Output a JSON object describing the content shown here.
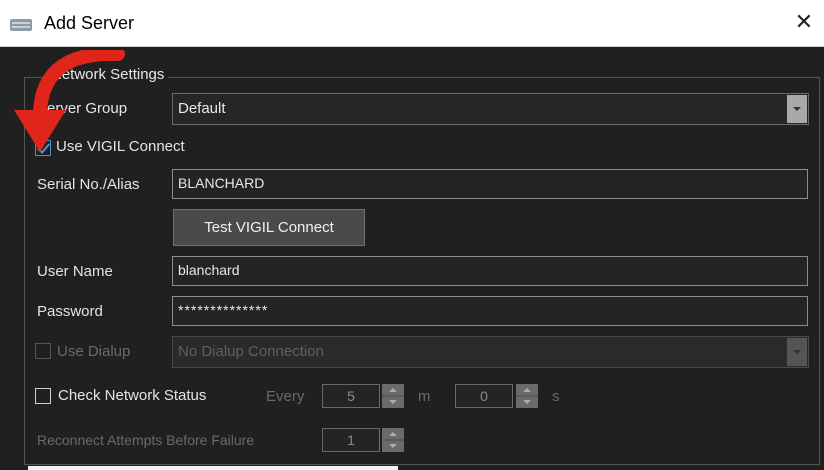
{
  "window": {
    "title": "Add Server",
    "close_glyph": "✕",
    "icon": "server-icon"
  },
  "group": {
    "legend": "Network Settings"
  },
  "server_group": {
    "label": "Server Group",
    "value": "Default"
  },
  "use_vigil_connect": {
    "label": "Use VIGIL Connect",
    "checked": true
  },
  "serial": {
    "label": "Serial No./Alias",
    "value": "BLANCHARD"
  },
  "test_button": {
    "label": "Test VIGIL Connect"
  },
  "user_name": {
    "label": "User Name",
    "value": "blanchard"
  },
  "password": {
    "label": "Password",
    "value": "**************"
  },
  "use_dialup": {
    "label": "Use Dialup",
    "checked": false,
    "value": "No Dialup Connection"
  },
  "check_network": {
    "label": "Check Network Status",
    "checked": false,
    "every_label": "Every",
    "minutes_value": "5",
    "minutes_unit": "m",
    "seconds_value": "0",
    "seconds_unit": "s"
  },
  "reconnect": {
    "label": "Reconnect Attempts Before Failure",
    "value": "1"
  },
  "annotation": {
    "arrow_color": "#e0261b"
  }
}
